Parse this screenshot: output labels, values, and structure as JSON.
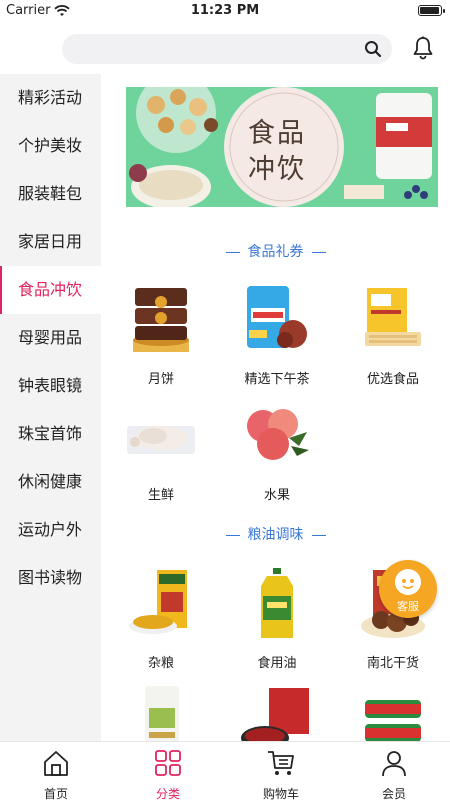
{
  "status_bar": {
    "carrier": "Carrier",
    "time": "11:23 PM"
  },
  "search": {
    "placeholder": ""
  },
  "sidebar": {
    "items": [
      {
        "label": "精彩活动"
      },
      {
        "label": "个护美妆"
      },
      {
        "label": "服装鞋包"
      },
      {
        "label": "家居日用"
      },
      {
        "label": "食品冲饮"
      },
      {
        "label": "母婴用品"
      },
      {
        "label": "钟表眼镜"
      },
      {
        "label": "珠宝首饰"
      },
      {
        "label": "休闲健康"
      },
      {
        "label": "运动户外"
      },
      {
        "label": "图书读物"
      }
    ],
    "active_index": 4
  },
  "banner": {
    "title_line1": "食品",
    "title_line2": "冲饮"
  },
  "sections": [
    {
      "title": "食品礼券",
      "items": [
        {
          "label": "月饼",
          "icon": "mooncake-icon"
        },
        {
          "label": "精选下午茶",
          "icon": "snack-bag-icon"
        },
        {
          "label": "优选食品",
          "icon": "biscuit-box-icon"
        },
        {
          "label": "生鲜",
          "icon": "fresh-meat-icon"
        },
        {
          "label": "水果",
          "icon": "peach-icon"
        }
      ]
    },
    {
      "title": "粮油调味",
      "items": [
        {
          "label": "杂粮",
          "icon": "grain-bag-icon"
        },
        {
          "label": "食用油",
          "icon": "oil-bottle-icon"
        },
        {
          "label": "南北干货",
          "icon": "dried-mushroom-icon"
        },
        {
          "label": "",
          "icon": "rice-bag-icon"
        },
        {
          "label": "",
          "icon": "sauce-pack-icon"
        },
        {
          "label": "",
          "icon": "canned-fish-icon"
        }
      ]
    }
  ],
  "service": {
    "label": "客服"
  },
  "tabbar": {
    "tabs": [
      {
        "label": "首页",
        "icon": "home-icon"
      },
      {
        "label": "分类",
        "icon": "category-icon"
      },
      {
        "label": "购物车",
        "icon": "cart-icon"
      },
      {
        "label": "会员",
        "icon": "member-icon"
      }
    ],
    "active_index": 1
  },
  "colors": {
    "accent": "#e0245e",
    "section_title": "#3a78d8",
    "banner_bg": "#6fd39c",
    "service_bg": "#f5a623"
  }
}
